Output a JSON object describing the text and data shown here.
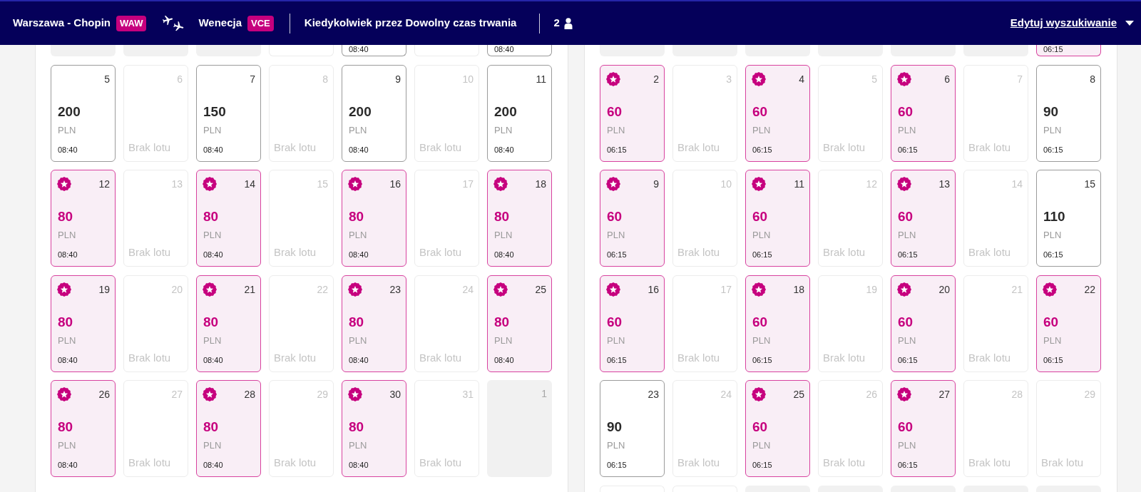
{
  "header": {
    "origin": {
      "city": "Warszawa - Chopin",
      "code": "WAW"
    },
    "destination": {
      "city": "Wenecja",
      "code": "VCE"
    },
    "dates": "Kiedykolwiek przez Dowolny czas trwania",
    "passengers": "2",
    "edit_link": "Edytuj wyszukiwanie"
  },
  "calendars": [
    {
      "top_partial_week": [
        {
          "kind": "outside"
        },
        {
          "kind": "outside"
        },
        {
          "kind": "outside"
        },
        {
          "kind": "no_flight"
        },
        {
          "kind": "fare",
          "time": "08:40",
          "promo": false
        },
        {
          "kind": "no_flight"
        },
        {
          "kind": "fare",
          "time": "08:40",
          "promo": false
        }
      ],
      "weeks": [
        [
          {
            "kind": "fare",
            "day": "5",
            "price": "200",
            "currency": "PLN",
            "time": "08:40",
            "promo": false
          },
          {
            "kind": "no_flight",
            "day": "6",
            "label": "Brak lotu"
          },
          {
            "kind": "fare",
            "day": "7",
            "price": "150",
            "currency": "PLN",
            "time": "08:40",
            "promo": false
          },
          {
            "kind": "no_flight",
            "day": "8",
            "label": "Brak lotu"
          },
          {
            "kind": "fare",
            "day": "9",
            "price": "200",
            "currency": "PLN",
            "time": "08:40",
            "promo": false
          },
          {
            "kind": "no_flight",
            "day": "10",
            "label": "Brak lotu"
          },
          {
            "kind": "fare",
            "day": "11",
            "price": "200",
            "currency": "PLN",
            "time": "08:40",
            "promo": false
          }
        ],
        [
          {
            "kind": "fare",
            "day": "12",
            "price": "80",
            "currency": "PLN",
            "time": "08:40",
            "promo": true
          },
          {
            "kind": "no_flight",
            "day": "13",
            "label": "Brak lotu"
          },
          {
            "kind": "fare",
            "day": "14",
            "price": "80",
            "currency": "PLN",
            "time": "08:40",
            "promo": true
          },
          {
            "kind": "no_flight",
            "day": "15",
            "label": "Brak lotu"
          },
          {
            "kind": "fare",
            "day": "16",
            "price": "80",
            "currency": "PLN",
            "time": "08:40",
            "promo": true
          },
          {
            "kind": "no_flight",
            "day": "17",
            "label": "Brak lotu"
          },
          {
            "kind": "fare",
            "day": "18",
            "price": "80",
            "currency": "PLN",
            "time": "08:40",
            "promo": true
          }
        ],
        [
          {
            "kind": "fare",
            "day": "19",
            "price": "80",
            "currency": "PLN",
            "time": "08:40",
            "promo": true
          },
          {
            "kind": "no_flight",
            "day": "20",
            "label": "Brak lotu"
          },
          {
            "kind": "fare",
            "day": "21",
            "price": "80",
            "currency": "PLN",
            "time": "08:40",
            "promo": true
          },
          {
            "kind": "no_flight",
            "day": "22",
            "label": "Brak lotu"
          },
          {
            "kind": "fare",
            "day": "23",
            "price": "80",
            "currency": "PLN",
            "time": "08:40",
            "promo": true
          },
          {
            "kind": "no_flight",
            "day": "24",
            "label": "Brak lotu"
          },
          {
            "kind": "fare",
            "day": "25",
            "price": "80",
            "currency": "PLN",
            "time": "08:40",
            "promo": true
          }
        ],
        [
          {
            "kind": "fare",
            "day": "26",
            "price": "80",
            "currency": "PLN",
            "time": "08:40",
            "promo": true
          },
          {
            "kind": "no_flight",
            "day": "27",
            "label": "Brak lotu"
          },
          {
            "kind": "fare",
            "day": "28",
            "price": "80",
            "currency": "PLN",
            "time": "08:40",
            "promo": true
          },
          {
            "kind": "no_flight",
            "day": "29",
            "label": "Brak lotu"
          },
          {
            "kind": "fare",
            "day": "30",
            "price": "80",
            "currency": "PLN",
            "time": "08:40",
            "promo": true
          },
          {
            "kind": "no_flight",
            "day": "31",
            "label": "Brak lotu"
          },
          {
            "kind": "outside",
            "day": "1"
          }
        ]
      ]
    },
    {
      "top_partial_week": [
        {
          "kind": "outside"
        },
        {
          "kind": "outside"
        },
        {
          "kind": "outside"
        },
        {
          "kind": "outside"
        },
        {
          "kind": "outside"
        },
        {
          "kind": "outside"
        },
        {
          "kind": "fare",
          "time": "06:15",
          "promo": true
        }
      ],
      "weeks": [
        [
          {
            "kind": "fare",
            "day": "2",
            "price": "60",
            "currency": "PLN",
            "time": "06:15",
            "promo": true
          },
          {
            "kind": "no_flight",
            "day": "3",
            "label": "Brak lotu"
          },
          {
            "kind": "fare",
            "day": "4",
            "price": "60",
            "currency": "PLN",
            "time": "06:15",
            "promo": true
          },
          {
            "kind": "no_flight",
            "day": "5",
            "label": "Brak lotu"
          },
          {
            "kind": "fare",
            "day": "6",
            "price": "60",
            "currency": "PLN",
            "time": "06:15",
            "promo": true
          },
          {
            "kind": "no_flight",
            "day": "7",
            "label": "Brak lotu"
          },
          {
            "kind": "fare",
            "day": "8",
            "price": "90",
            "currency": "PLN",
            "time": "06:15",
            "promo": false
          }
        ],
        [
          {
            "kind": "fare",
            "day": "9",
            "price": "60",
            "currency": "PLN",
            "time": "06:15",
            "promo": true
          },
          {
            "kind": "no_flight",
            "day": "10",
            "label": "Brak lotu"
          },
          {
            "kind": "fare",
            "day": "11",
            "price": "60",
            "currency": "PLN",
            "time": "06:15",
            "promo": true
          },
          {
            "kind": "no_flight",
            "day": "12",
            "label": "Brak lotu"
          },
          {
            "kind": "fare",
            "day": "13",
            "price": "60",
            "currency": "PLN",
            "time": "06:15",
            "promo": true
          },
          {
            "kind": "no_flight",
            "day": "14",
            "label": "Brak lotu"
          },
          {
            "kind": "fare",
            "day": "15",
            "price": "110",
            "currency": "PLN",
            "time": "06:15",
            "promo": false
          }
        ],
        [
          {
            "kind": "fare",
            "day": "16",
            "price": "60",
            "currency": "PLN",
            "time": "06:15",
            "promo": true
          },
          {
            "kind": "no_flight",
            "day": "17",
            "label": "Brak lotu"
          },
          {
            "kind": "fare",
            "day": "18",
            "price": "60",
            "currency": "PLN",
            "time": "06:15",
            "promo": true
          },
          {
            "kind": "no_flight",
            "day": "19",
            "label": "Brak lotu"
          },
          {
            "kind": "fare",
            "day": "20",
            "price": "60",
            "currency": "PLN",
            "time": "06:15",
            "promo": true
          },
          {
            "kind": "no_flight",
            "day": "21",
            "label": "Brak lotu"
          },
          {
            "kind": "fare",
            "day": "22",
            "price": "60",
            "currency": "PLN",
            "time": "06:15",
            "promo": true
          }
        ],
        [
          {
            "kind": "fare",
            "day": "23",
            "price": "90",
            "currency": "PLN",
            "time": "06:15",
            "promo": false
          },
          {
            "kind": "no_flight",
            "day": "24",
            "label": "Brak lotu"
          },
          {
            "kind": "fare",
            "day": "25",
            "price": "60",
            "currency": "PLN",
            "time": "06:15",
            "promo": true
          },
          {
            "kind": "no_flight",
            "day": "26",
            "label": "Brak lotu"
          },
          {
            "kind": "fare",
            "day": "27",
            "price": "60",
            "currency": "PLN",
            "time": "06:15",
            "promo": true
          },
          {
            "kind": "no_flight",
            "day": "28",
            "label": "Brak lotu"
          },
          {
            "kind": "no_flight",
            "day": "29",
            "label": "Brak lotu"
          }
        ]
      ],
      "bottom_partial_week": [
        {
          "kind": "no_flight"
        },
        {
          "kind": "no_flight"
        },
        {
          "kind": "outside"
        },
        {
          "kind": "outside"
        },
        {
          "kind": "outside"
        },
        {
          "kind": "outside"
        },
        {
          "kind": "outside"
        }
      ]
    }
  ]
}
